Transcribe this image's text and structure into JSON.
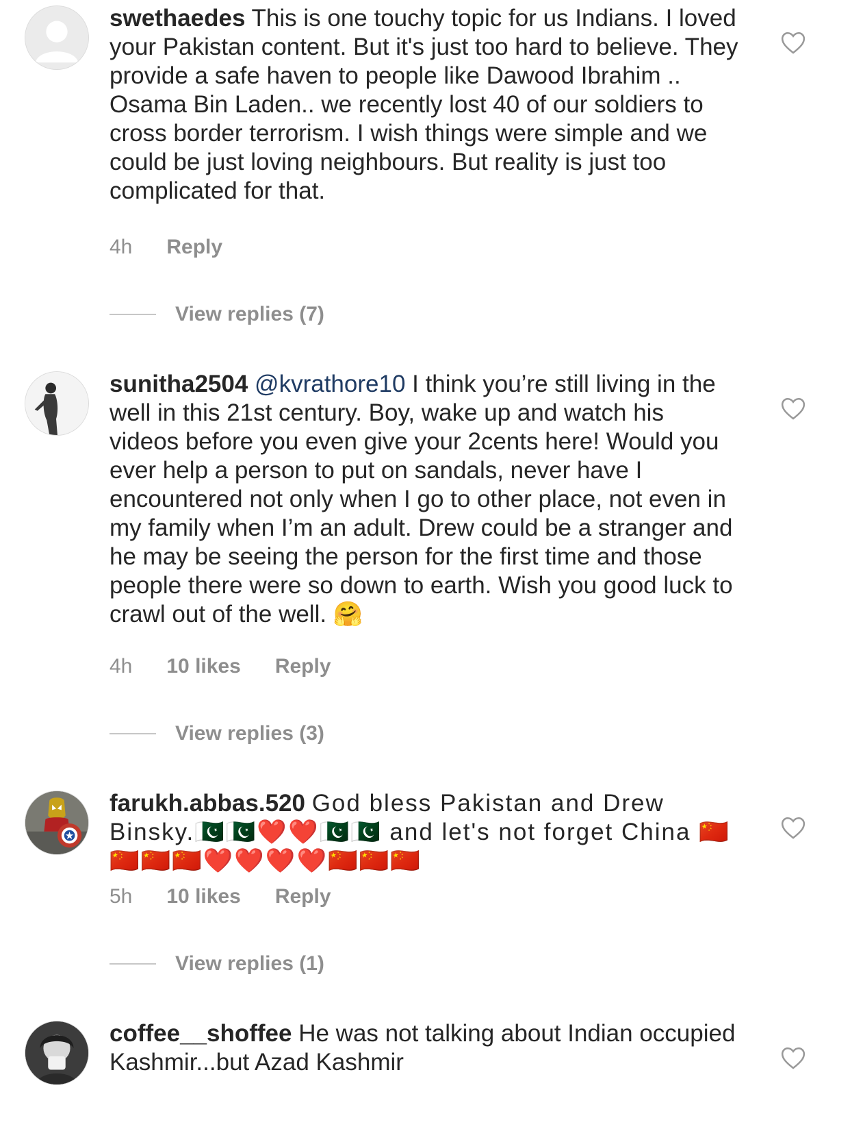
{
  "comments": [
    {
      "username": "swethaedes",
      "mention": "",
      "text": "This is one touchy topic for us Indians. I loved your Pakistan content. But it's just too hard to believe. They provide a safe haven to people like Dawood Ibrahim .. Osama Bin Laden.. we recently lost 40 of our soldiers to cross border terrorism. I wish things were simple and we could be just loving neighbours. But reality is just too complicated for that.",
      "time": "4h",
      "likes": "",
      "reply_label": "Reply",
      "view_replies": "View replies (7)"
    },
    {
      "username": "sunitha2504",
      "mention": "@kvrathore10",
      "text": " I think you’re still living in the well in this 21st century. Boy, wake up and watch his videos before you even give your 2cents here! Would you ever help a person to put on sandals, never have I encountered not only when I go to other place, not even in my family when I’m an adult. Drew could be a stranger and he may be seeing the person for the first time and those people there were so down to earth. Wish you good luck to crawl out of the well. 🤗",
      "time": "4h",
      "likes": "10 likes",
      "reply_label": "Reply",
      "view_replies": "View replies (3)"
    },
    {
      "username": "farukh.abbas.520",
      "mention": "",
      "text": "God bless Pakistan and Drew Binsky.🇵🇰🇵🇰❤️❤️🇵🇰🇵🇰 and let's not forget China 🇨🇳🇨🇳🇨🇳🇨🇳❤️❤️❤️❤️🇨🇳🇨🇳🇨🇳",
      "time": "5h",
      "likes": "10 likes",
      "reply_label": "Reply",
      "view_replies": "View replies (1)"
    },
    {
      "username": "coffee__shoffee",
      "mention": "",
      "text": "He was not talking about Indian occupied Kashmir...but Azad Kashmir",
      "time": "",
      "likes": "",
      "reply_label": "",
      "view_replies": ""
    }
  ],
  "icons": {
    "like": "heart-outline-icon",
    "avatar_placeholder": "person-placeholder-icon"
  },
  "colors": {
    "text": "#262626",
    "meta": "#8e8e8e",
    "mention": "#1f3b63"
  }
}
